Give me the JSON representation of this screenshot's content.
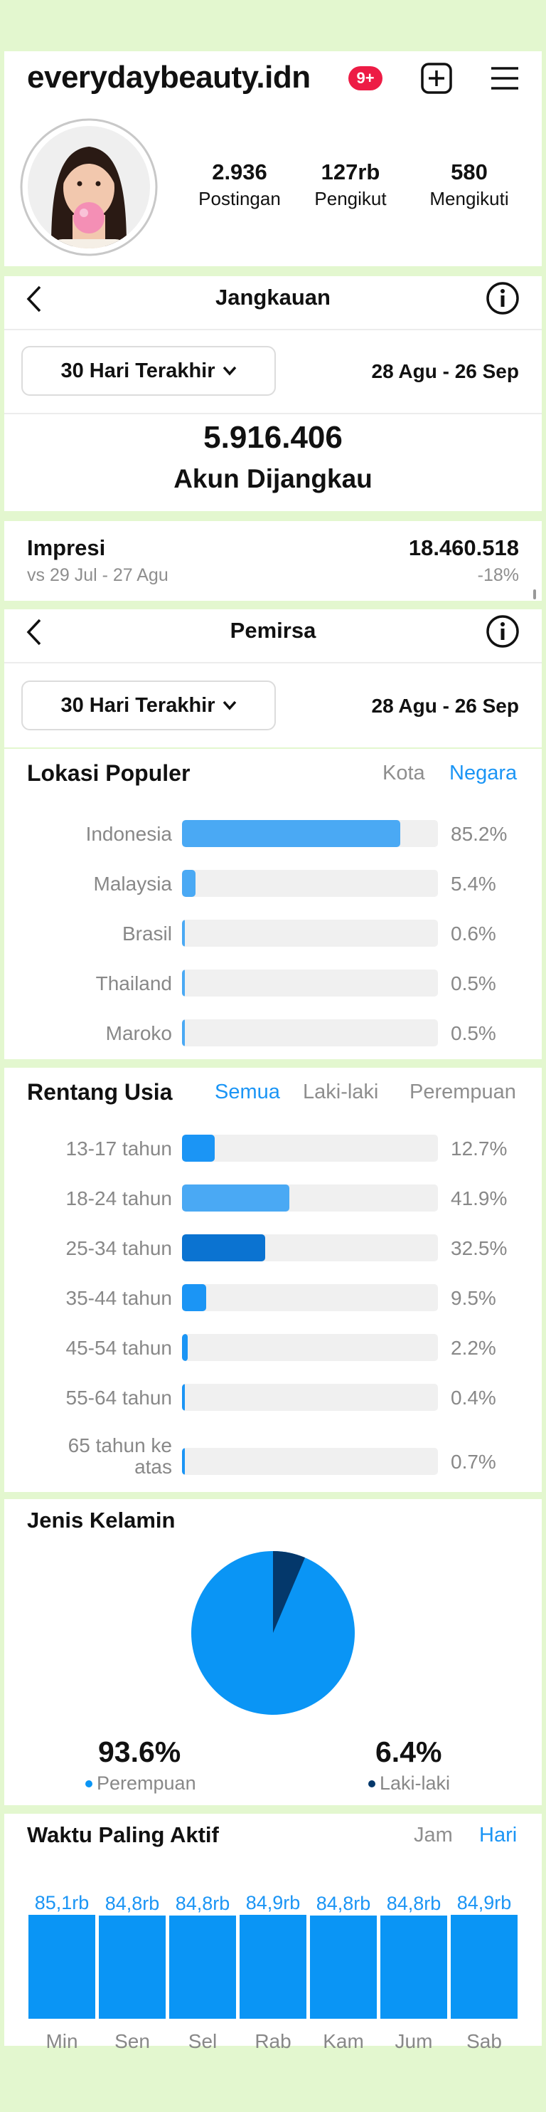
{
  "profile": {
    "username": "everydaybeauty.idn",
    "notif_badge": "9+",
    "stats": [
      {
        "value": "2.936",
        "label": "Postingan"
      },
      {
        "value": "127rb",
        "label": "Pengikut"
      },
      {
        "value": "580",
        "label": "Mengikuti"
      }
    ]
  },
  "reach": {
    "title": "Jangkauan",
    "range_label": "30 Hari Terakhir",
    "date_range": "28 Agu - 26 Sep",
    "accounts_reached": "5.916.406",
    "accounts_reached_label": "Akun Dijangkau",
    "impressions_label": "Impresi",
    "impressions_value": "18.460.518",
    "compare_period": "vs 29 Jul - 27 Agu",
    "compare_change": "-18%"
  },
  "audience": {
    "title": "Pemirsa",
    "range_label": "30 Hari Terakhir",
    "date_range": "28 Agu - 26 Sep",
    "locations": {
      "title": "Lokasi Populer",
      "tab_city": "Kota",
      "tab_country": "Negara",
      "items": [
        {
          "label": "Indonesia",
          "pct": "85.2%",
          "value": 85.2
        },
        {
          "label": "Malaysia",
          "pct": "5.4%",
          "value": 5.4
        },
        {
          "label": "Brasil",
          "pct": "0.6%",
          "value": 0.6
        },
        {
          "label": "Thailand",
          "pct": "0.5%",
          "value": 0.5
        },
        {
          "label": "Maroko",
          "pct": "0.5%",
          "value": 0.5
        }
      ]
    },
    "age": {
      "title": "Rentang Usia",
      "tab_all": "Semua",
      "tab_male": "Laki-laki",
      "tab_female": "Perempuan",
      "items": [
        {
          "label": "13-17 tahun",
          "pct": "12.7%",
          "value": 12.7
        },
        {
          "label": "18-24 tahun",
          "pct": "41.9%",
          "value": 41.9
        },
        {
          "label": "25-34 tahun",
          "pct": "32.5%",
          "value": 32.5
        },
        {
          "label": "35-44 tahun",
          "pct": "9.5%",
          "value": 9.5
        },
        {
          "label": "45-54 tahun",
          "pct": "2.2%",
          "value": 2.2
        },
        {
          "label": "55-64 tahun",
          "pct": "0.4%",
          "value": 0.4
        },
        {
          "label": "65 tahun ke atas",
          "pct": "0.7%",
          "value": 0.7
        }
      ]
    },
    "gender": {
      "title": "Jenis Kelamin",
      "female_pct": "93.6%",
      "female_label": "Perempuan",
      "male_pct": "6.4%",
      "male_label": "Laki-laki"
    },
    "active": {
      "title": "Waktu Paling Aktif",
      "tab_hours": "Jam",
      "tab_days": "Hari"
    }
  },
  "colors": {
    "accent": "#1b95f5",
    "bar_light": "#4aa9f4",
    "bar_dark": "#0b73d1",
    "gender_female": "#0a95f5",
    "gender_male": "#04386b",
    "background": "#e3f7cf"
  },
  "chart_data": [
    {
      "type": "pie",
      "categories": [
        "Perempuan",
        "Laki-laki"
      ],
      "values": [
        93.6,
        6.4
      ]
    },
    {
      "type": "bar",
      "categories": [
        "Min",
        "Sen",
        "Sel",
        "Rab",
        "Kam",
        "Jum",
        "Sab"
      ],
      "values": [
        85.1,
        84.8,
        84.8,
        84.9,
        84.8,
        84.8,
        84.9
      ],
      "value_labels": [
        "85,1rb",
        "84,8rb",
        "84,8rb",
        "84,9rb",
        "84,8rb",
        "84,8rb",
        "84,9rb"
      ],
      "unit": "rb"
    }
  ]
}
